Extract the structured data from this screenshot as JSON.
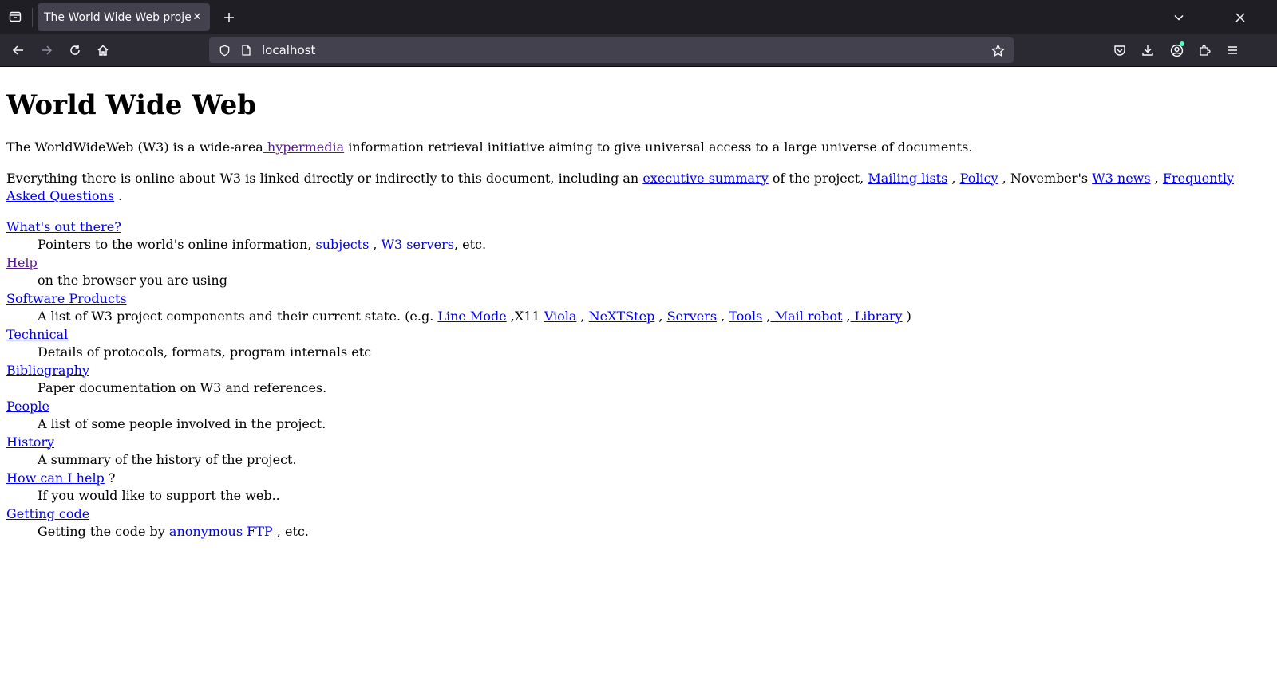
{
  "browser": {
    "tab_title": "The World Wide Web project",
    "url": "localhost",
    "colors": {
      "chrome_dark": "#1f1e25",
      "toolbar": "#2b2a33",
      "urlbar": "#42414d"
    }
  },
  "page": {
    "heading": "World Wide Web",
    "intro": {
      "before": "The WorldWideWeb (W3) is a wide-area",
      "link": " hypermedia",
      "after": " information retrieval initiative aiming to give universal access to a large universe of documents."
    },
    "everything": {
      "before": "Everything there is online about W3 is linked directly or indirectly to this document, including an ",
      "link_exec": "executive summary",
      "text1": " of the project, ",
      "link_mailing": "Mailing lists",
      "text2": " , ",
      "link_policy": "Policy",
      "text3": " , November's ",
      "link_news": "W3 news",
      "text4": " , ",
      "link_faq": "Frequently Asked Questions",
      "text5": " ."
    },
    "items": [
      {
        "term": "What's out there?",
        "desc_before": "Pointers to the world's online information,",
        "link1": " subjects",
        "sep1": " , ",
        "link2": "W3 servers",
        "desc_after": ", etc."
      },
      {
        "term": "Help",
        "desc": "on the browser you are using"
      },
      {
        "term": "Software Products",
        "desc_before": "A list of W3 project components and their current state. (e.g. ",
        "links": [
          "Line Mode",
          "Viola",
          "NeXTStep",
          "Servers",
          "Tools",
          " Mail robot",
          " Library"
        ],
        "seps": [
          " ,X11 ",
          " , ",
          " , ",
          " , ",
          " ,",
          " ,",
          " )"
        ]
      },
      {
        "term": "Technical",
        "desc": "Details of protocols, formats, program internals etc"
      },
      {
        "term": "Bibliography",
        "desc": "Paper documentation on W3 and references."
      },
      {
        "term": "People",
        "desc": "A list of some people involved in the project."
      },
      {
        "term": "History",
        "desc": "A summary of the history of the project."
      },
      {
        "term": "How can I help",
        "term_after": " ?",
        "desc": "If you would like to support the web.."
      },
      {
        "term": "Getting code",
        "desc_before": "Getting the code by",
        "link1": " anonymous FTP",
        "desc_after": " , etc."
      }
    ]
  }
}
